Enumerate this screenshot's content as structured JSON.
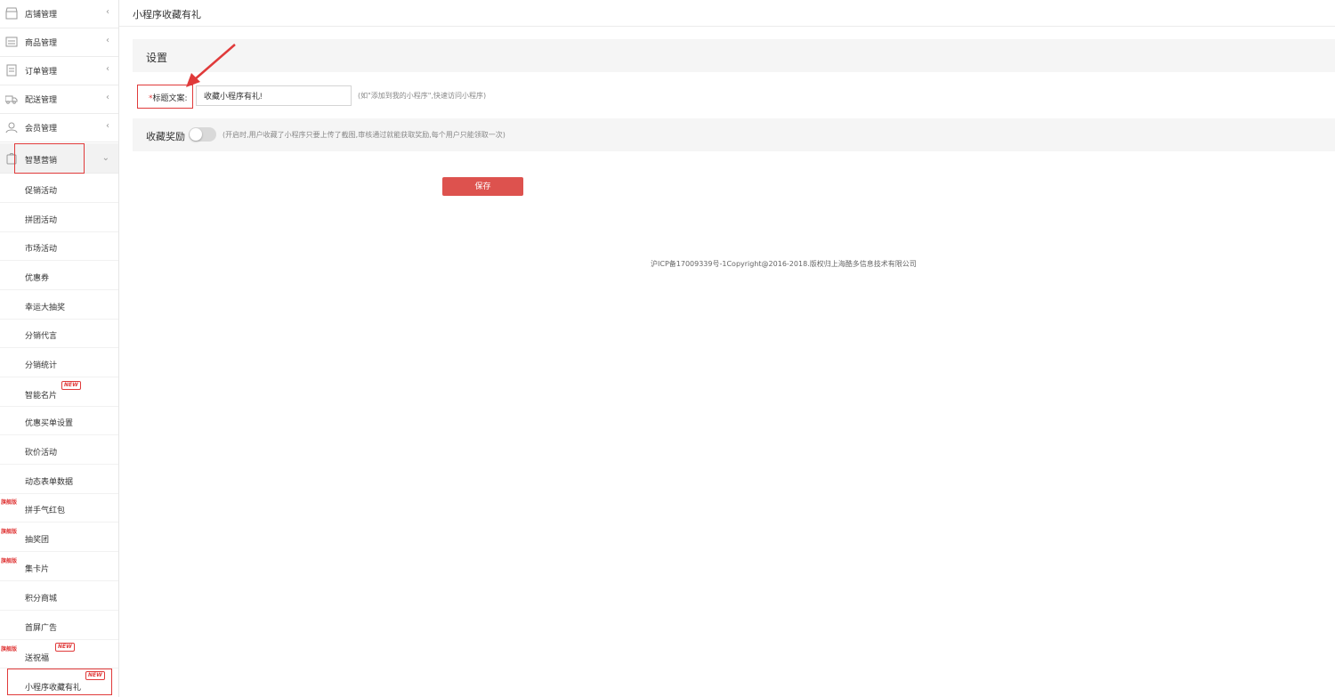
{
  "sidebar": {
    "menus": [
      {
        "label": "店铺管理",
        "icon": "shop-icon"
      },
      {
        "label": "商品管理",
        "icon": "goods-icon"
      },
      {
        "label": "订单管理",
        "icon": "order-icon"
      },
      {
        "label": "配送管理",
        "icon": "truck-icon"
      },
      {
        "label": "会员管理",
        "icon": "user-icon"
      },
      {
        "label": "智慧营销",
        "icon": "bag-icon"
      }
    ],
    "subitems": [
      {
        "label": "促销活动"
      },
      {
        "label": "拼团活动"
      },
      {
        "label": "市场活动"
      },
      {
        "label": "优惠券"
      },
      {
        "label": "幸运大抽奖"
      },
      {
        "label": "分销代言"
      },
      {
        "label": "分销统计"
      },
      {
        "label": "智能名片",
        "new": "NEW"
      },
      {
        "label": "优惠买单设置"
      },
      {
        "label": "砍价活动"
      },
      {
        "label": "动态表单数据"
      },
      {
        "label": "拼手气红包",
        "flag": "旗舰版"
      },
      {
        "label": "抽奖团",
        "flag": "旗舰版"
      },
      {
        "label": "集卡片",
        "flag": "旗舰版"
      },
      {
        "label": "积分商城"
      },
      {
        "label": "首屏广告"
      },
      {
        "label": "送祝福",
        "flag": "旗舰版",
        "new": "NEW"
      },
      {
        "label": "小程序收藏有礼",
        "new": "NEW"
      }
    ]
  },
  "header": {
    "title": "小程序收藏有礼"
  },
  "settings": {
    "section_title": "设置",
    "title_field": {
      "required_mark": "*",
      "label": "标题文案:",
      "value": "收藏小程序有礼!",
      "hint": "(如\"添加到我的小程序\",快速访问小程序)"
    },
    "reward": {
      "label": "收藏奖励",
      "toggle_on": false,
      "hint": "(开启时,用户收藏了小程序只要上传了截图,审核通过就能获取奖励,每个用户只能领取一次)"
    },
    "save_label": "保存"
  },
  "footer": {
    "text": "沪ICP备17009339号-1Copyright@2016-2018.版权归上海酷多信息技术有限公司"
  },
  "colors": {
    "accent": "#dd524e",
    "highlight": "#e03a3a"
  }
}
